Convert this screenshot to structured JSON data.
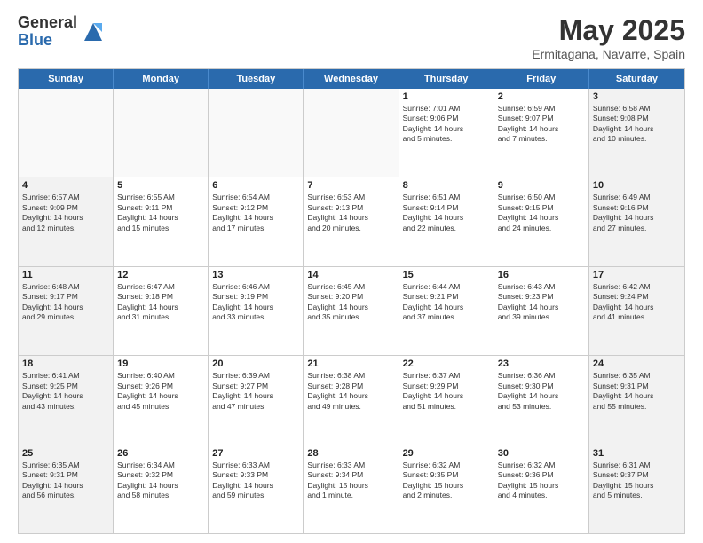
{
  "logo": {
    "general": "General",
    "blue": "Blue"
  },
  "title": "May 2025",
  "location": "Ermitagana, Navarre, Spain",
  "days_of_week": [
    "Sunday",
    "Monday",
    "Tuesday",
    "Wednesday",
    "Thursday",
    "Friday",
    "Saturday"
  ],
  "weeks": [
    [
      {
        "day": "",
        "info": ""
      },
      {
        "day": "",
        "info": ""
      },
      {
        "day": "",
        "info": ""
      },
      {
        "day": "",
        "info": ""
      },
      {
        "day": "1",
        "info": "Sunrise: 7:01 AM\nSunset: 9:06 PM\nDaylight: 14 hours\nand 5 minutes."
      },
      {
        "day": "2",
        "info": "Sunrise: 6:59 AM\nSunset: 9:07 PM\nDaylight: 14 hours\nand 7 minutes."
      },
      {
        "day": "3",
        "info": "Sunrise: 6:58 AM\nSunset: 9:08 PM\nDaylight: 14 hours\nand 10 minutes."
      }
    ],
    [
      {
        "day": "4",
        "info": "Sunrise: 6:57 AM\nSunset: 9:09 PM\nDaylight: 14 hours\nand 12 minutes."
      },
      {
        "day": "5",
        "info": "Sunrise: 6:55 AM\nSunset: 9:11 PM\nDaylight: 14 hours\nand 15 minutes."
      },
      {
        "day": "6",
        "info": "Sunrise: 6:54 AM\nSunset: 9:12 PM\nDaylight: 14 hours\nand 17 minutes."
      },
      {
        "day": "7",
        "info": "Sunrise: 6:53 AM\nSunset: 9:13 PM\nDaylight: 14 hours\nand 20 minutes."
      },
      {
        "day": "8",
        "info": "Sunrise: 6:51 AM\nSunset: 9:14 PM\nDaylight: 14 hours\nand 22 minutes."
      },
      {
        "day": "9",
        "info": "Sunrise: 6:50 AM\nSunset: 9:15 PM\nDaylight: 14 hours\nand 24 minutes."
      },
      {
        "day": "10",
        "info": "Sunrise: 6:49 AM\nSunset: 9:16 PM\nDaylight: 14 hours\nand 27 minutes."
      }
    ],
    [
      {
        "day": "11",
        "info": "Sunrise: 6:48 AM\nSunset: 9:17 PM\nDaylight: 14 hours\nand 29 minutes."
      },
      {
        "day": "12",
        "info": "Sunrise: 6:47 AM\nSunset: 9:18 PM\nDaylight: 14 hours\nand 31 minutes."
      },
      {
        "day": "13",
        "info": "Sunrise: 6:46 AM\nSunset: 9:19 PM\nDaylight: 14 hours\nand 33 minutes."
      },
      {
        "day": "14",
        "info": "Sunrise: 6:45 AM\nSunset: 9:20 PM\nDaylight: 14 hours\nand 35 minutes."
      },
      {
        "day": "15",
        "info": "Sunrise: 6:44 AM\nSunset: 9:21 PM\nDaylight: 14 hours\nand 37 minutes."
      },
      {
        "day": "16",
        "info": "Sunrise: 6:43 AM\nSunset: 9:23 PM\nDaylight: 14 hours\nand 39 minutes."
      },
      {
        "day": "17",
        "info": "Sunrise: 6:42 AM\nSunset: 9:24 PM\nDaylight: 14 hours\nand 41 minutes."
      }
    ],
    [
      {
        "day": "18",
        "info": "Sunrise: 6:41 AM\nSunset: 9:25 PM\nDaylight: 14 hours\nand 43 minutes."
      },
      {
        "day": "19",
        "info": "Sunrise: 6:40 AM\nSunset: 9:26 PM\nDaylight: 14 hours\nand 45 minutes."
      },
      {
        "day": "20",
        "info": "Sunrise: 6:39 AM\nSunset: 9:27 PM\nDaylight: 14 hours\nand 47 minutes."
      },
      {
        "day": "21",
        "info": "Sunrise: 6:38 AM\nSunset: 9:28 PM\nDaylight: 14 hours\nand 49 minutes."
      },
      {
        "day": "22",
        "info": "Sunrise: 6:37 AM\nSunset: 9:29 PM\nDaylight: 14 hours\nand 51 minutes."
      },
      {
        "day": "23",
        "info": "Sunrise: 6:36 AM\nSunset: 9:30 PM\nDaylight: 14 hours\nand 53 minutes."
      },
      {
        "day": "24",
        "info": "Sunrise: 6:35 AM\nSunset: 9:31 PM\nDaylight: 14 hours\nand 55 minutes."
      }
    ],
    [
      {
        "day": "25",
        "info": "Sunrise: 6:35 AM\nSunset: 9:31 PM\nDaylight: 14 hours\nand 56 minutes."
      },
      {
        "day": "26",
        "info": "Sunrise: 6:34 AM\nSunset: 9:32 PM\nDaylight: 14 hours\nand 58 minutes."
      },
      {
        "day": "27",
        "info": "Sunrise: 6:33 AM\nSunset: 9:33 PM\nDaylight: 14 hours\nand 59 minutes."
      },
      {
        "day": "28",
        "info": "Sunrise: 6:33 AM\nSunset: 9:34 PM\nDaylight: 15 hours\nand 1 minute."
      },
      {
        "day": "29",
        "info": "Sunrise: 6:32 AM\nSunset: 9:35 PM\nDaylight: 15 hours\nand 2 minutes."
      },
      {
        "day": "30",
        "info": "Sunrise: 6:32 AM\nSunset: 9:36 PM\nDaylight: 15 hours\nand 4 minutes."
      },
      {
        "day": "31",
        "info": "Sunrise: 6:31 AM\nSunset: 9:37 PM\nDaylight: 15 hours\nand 5 minutes."
      }
    ]
  ]
}
